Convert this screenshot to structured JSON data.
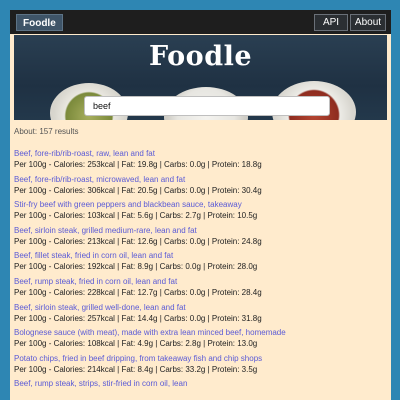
{
  "navbar": {
    "brand": "Foodle",
    "links": {
      "api": "API",
      "about": "About"
    }
  },
  "hero": {
    "title": "Foodle",
    "search_value": "beef"
  },
  "about_text": "About: 157 results",
  "results": [
    {
      "name": "Beef, fore-rib/rib-roast, raw, lean and fat",
      "info": "Per 100g - Calories: 253kcal | Fat: 19.8g | Carbs: 0.0g | Protein: 18.8g"
    },
    {
      "name": "Beef, fore-rib/rib-roast, microwaved, lean and fat",
      "info": "Per 100g - Calories: 306kcal | Fat: 20.5g | Carbs: 0.0g | Protein: 30.4g"
    },
    {
      "name": "Stir-fry beef with green peppers and blackbean sauce, takeaway",
      "info": "Per 100g - Calories: 103kcal | Fat: 5.6g | Carbs: 2.7g | Protein: 10.5g"
    },
    {
      "name": "Beef, sirloin steak, grilled medium-rare, lean and fat",
      "info": "Per 100g - Calories: 213kcal | Fat: 12.6g | Carbs: 0.0g | Protein: 24.8g"
    },
    {
      "name": "Beef, fillet steak, fried in corn oil, lean and fat",
      "info": "Per 100g - Calories: 192kcal | Fat: 8.9g | Carbs: 0.0g | Protein: 28.0g"
    },
    {
      "name": "Beef, rump steak, fried in corn oil, lean and fat",
      "info": "Per 100g - Calories: 228kcal | Fat: 12.7g | Carbs: 0.0g | Protein: 28.4g"
    },
    {
      "name": "Beef, sirloin steak, grilled well-done, lean and fat",
      "info": "Per 100g - Calories: 257kcal | Fat: 14.4g | Carbs: 0.0g | Protein: 31.8g"
    },
    {
      "name": "Bolognese sauce (with meat), made with extra lean minced beef, homemade",
      "info": "Per 100g - Calories: 108kcal | Fat: 4.9g | Carbs: 2.8g | Protein: 13.0g"
    },
    {
      "name": "Potato chips, fried in beef dripping, from takeaway fish and chip shops",
      "info": "Per 100g - Calories: 214kcal | Fat: 8.4g | Carbs: 33.2g | Protein: 3.5g"
    },
    {
      "name": "Beef, rump steak, strips, stir-fried in corn oil, lean",
      "info": ""
    }
  ],
  "colors": {
    "page_background": "#2e86b3",
    "content_background": "#ffebcd",
    "navbar": "#1e1e1e",
    "brand_button": "#3e5468",
    "result_link": "#5a5ad6"
  }
}
